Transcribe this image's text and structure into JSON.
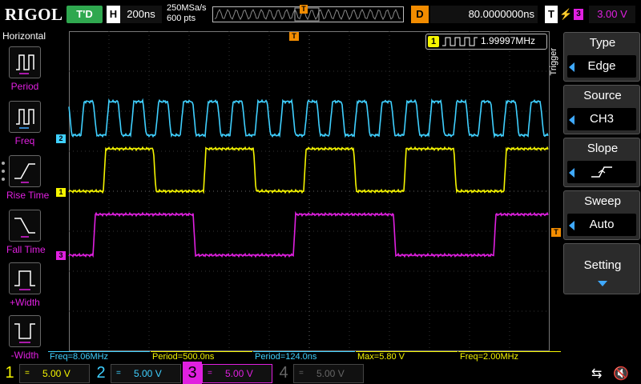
{
  "header": {
    "brand": "RIGOL",
    "run_state": "T'D",
    "timebase_label": "H",
    "timebase_value": "200ns",
    "sample_rate": "250MSa/s",
    "memory_depth": "600 pts",
    "trigger_position_marker": "T",
    "delay_label": "D",
    "delay_value": "80.0000000ns",
    "trigger_label": "T",
    "trigger_channel": "3",
    "trigger_level": "3.00 V"
  },
  "left_panel": {
    "title": "Horizontal",
    "items": [
      {
        "label": "Period",
        "icon": "period-icon"
      },
      {
        "label": "Freq",
        "icon": "frequency-icon"
      },
      {
        "label": "Rise Time",
        "icon": "rise-time-icon"
      },
      {
        "label": "Fall Time",
        "icon": "fall-time-icon"
      },
      {
        "label": "+Width",
        "icon": "positive-width-icon"
      },
      {
        "label": "-Width",
        "icon": "negative-width-icon"
      }
    ]
  },
  "freq_counter": {
    "channel": "1",
    "value": "1.99997MHz"
  },
  "channel_markers": {
    "ch1": "1",
    "ch2": "2",
    "ch3": "3",
    "trigger_level": "T",
    "trigger_time": "T"
  },
  "right_menu": {
    "side_label": "Trigger",
    "buttons": [
      {
        "title": "Type",
        "value": "Edge"
      },
      {
        "title": "Source",
        "value": "CH3"
      },
      {
        "title": "Slope",
        "value": ""
      },
      {
        "title": "Sweep",
        "value": "Auto"
      },
      {
        "title": "Setting",
        "value": ""
      }
    ]
  },
  "measurements": [
    {
      "text": "Freq=8.06MHz",
      "color": "#3fd0ff"
    },
    {
      "text": "Period=500.0ns",
      "color": "#f5f500"
    },
    {
      "text": "Period=124.0ns",
      "color": "#3fd0ff"
    },
    {
      "text": "Max=5.80 V",
      "color": "#f5f500"
    },
    {
      "text": "Freq=2.00MHz",
      "color": "#f5f500"
    }
  ],
  "channels": [
    {
      "num": "1",
      "coupling": "=",
      "scale": "5.00 V",
      "color": "#f5f500",
      "active": true
    },
    {
      "num": "2",
      "coupling": "=",
      "scale": "5.00 V",
      "color": "#3fd0ff",
      "active": true
    },
    {
      "num": "3",
      "coupling": "=",
      "scale": "5.00 V",
      "color": "#e020e0",
      "active": true
    },
    {
      "num": "4",
      "coupling": "=",
      "scale": "5.00 V",
      "color": "#666666",
      "active": false
    }
  ],
  "colors": {
    "ch1": "#f5f500",
    "ch2": "#3fd0ff",
    "ch3": "#e020e0",
    "trigger": "#f28c00",
    "accent": "#3fa9ff"
  },
  "status_icons": [
    "usb-icon",
    "speaker-icon"
  ]
}
